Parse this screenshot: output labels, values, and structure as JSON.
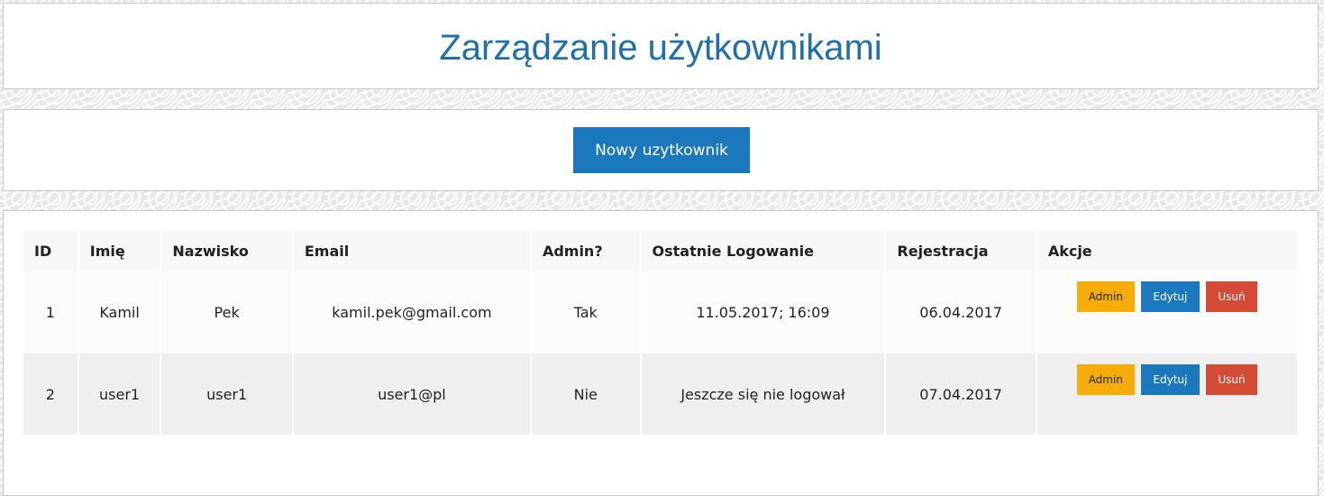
{
  "header": {
    "title": "Zarządzanie użytkownikami"
  },
  "actions": {
    "new_user_label": "Nowy uzytkownik"
  },
  "table": {
    "columns": [
      "ID",
      "Imię",
      "Nazwisko",
      "Email",
      "Admin?",
      "Ostatnie Logowanie",
      "Rejestracja",
      "Akcje"
    ],
    "rows": [
      {
        "id": "1",
        "first_name": "Kamil",
        "last_name": "Pek",
        "email": "kamil.pek@gmail.com",
        "admin": "Tak",
        "last_login": "11.05.2017; 16:09",
        "registered": "06.04.2017"
      },
      {
        "id": "2",
        "first_name": "user1",
        "last_name": "user1",
        "email": "user1@pl",
        "admin": "Nie",
        "last_login": "Jeszcze się nie logował",
        "registered": "07.04.2017"
      }
    ],
    "row_actions": {
      "admin_label": "Admin",
      "edit_label": "Edytuj",
      "delete_label": "Usuń"
    }
  },
  "colors": {
    "accent": "#1c78bd",
    "title": "#1f6fae",
    "admin_button": "#f7ad08",
    "delete_button": "#d34a35"
  }
}
